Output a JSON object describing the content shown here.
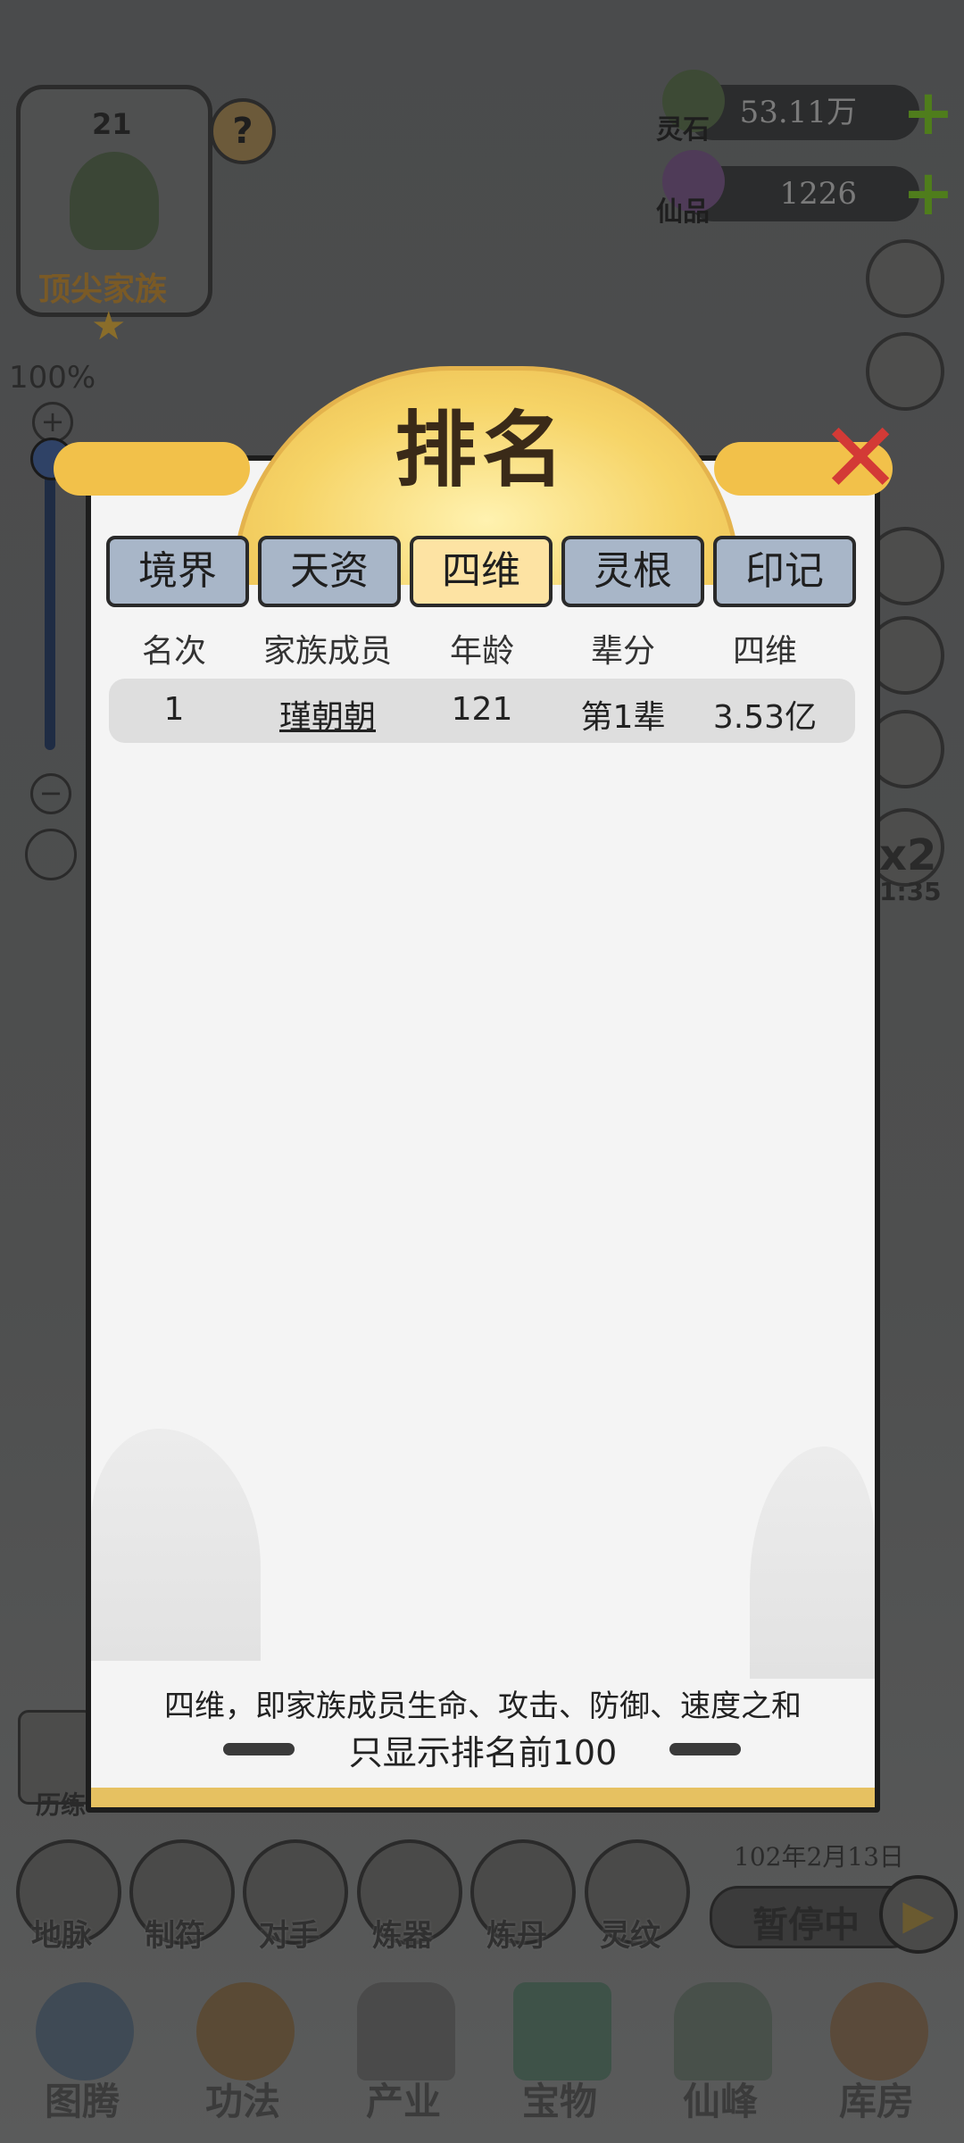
{
  "hud": {
    "family_level": "21",
    "family_rank": "顶尖家族",
    "help_icon": "?",
    "zoom_percent": "100%",
    "zoom_plus": "+",
    "zoom_minus": "−",
    "spirit_stone_label": "灵石",
    "spirit_stone_value": "53.11万",
    "immortal_crystal_label": "仙品",
    "immortal_crystal_value": "1226",
    "speed_boost": "x2",
    "speed_timer": "1:35",
    "date": "102年2月13日",
    "pause_label": "暂停中",
    "history_label": "历练"
  },
  "shortcuts": [
    "地脉",
    "制符",
    "对手",
    "炼器",
    "炼丹",
    "灵纹"
  ],
  "nav": [
    "图腾",
    "功法",
    "产业",
    "宝物",
    "仙峰",
    "库房"
  ],
  "modal": {
    "title": "排名",
    "tabs": [
      {
        "label": "境界",
        "active": false
      },
      {
        "label": "天资",
        "active": false
      },
      {
        "label": "四维",
        "active": true
      },
      {
        "label": "灵根",
        "active": false
      },
      {
        "label": "印记",
        "active": false
      }
    ],
    "columns": [
      "名次",
      "家族成员",
      "年龄",
      "辈分",
      "四维"
    ],
    "rows": [
      {
        "rank": "1",
        "member": "瑾朝朝",
        "age": "121",
        "generation": "第1辈",
        "stats": "3.53亿"
      }
    ],
    "note_line1": "四维，即家族成员生命、攻击、防御、速度之和",
    "note_line2": "只显示排名前100"
  },
  "colors": {
    "tab_inactive": "#a8b6c8",
    "tab_active": "#fde3a3",
    "title_gold": "#f2c14a",
    "close_red": "#d33a36"
  }
}
